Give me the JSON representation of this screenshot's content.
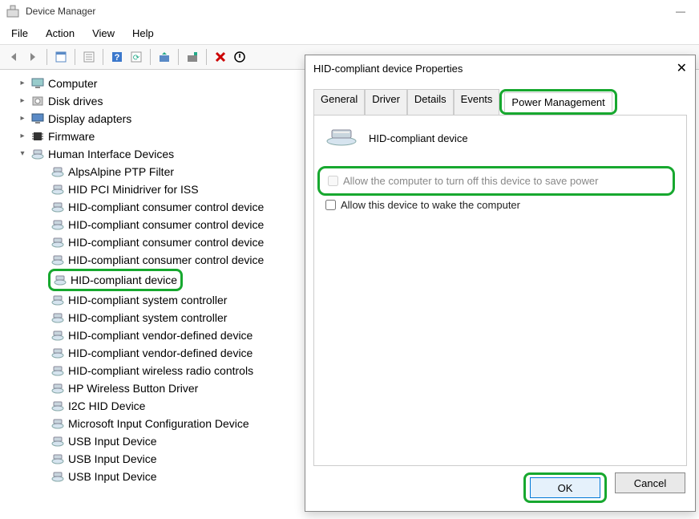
{
  "window": {
    "title": "Device Manager"
  },
  "menu": {
    "file": "File",
    "action": "Action",
    "view": "View",
    "help": "Help"
  },
  "toolbar_icons": [
    "back",
    "forward",
    "show",
    "properties",
    "help",
    "refresh",
    "monitor",
    "scan",
    "delete",
    "updown"
  ],
  "tree": {
    "categories": [
      {
        "label": "Computer",
        "expanded": false,
        "icon": "monitor"
      },
      {
        "label": "Disk drives",
        "expanded": false,
        "icon": "disk"
      },
      {
        "label": "Display adapters",
        "expanded": false,
        "icon": "display"
      },
      {
        "label": "Firmware",
        "expanded": false,
        "icon": "chip"
      },
      {
        "label": "Human Interface Devices",
        "expanded": true,
        "icon": "hid",
        "children": [
          "AlpsAlpine PTP Filter",
          "HID PCI Minidriver for ISS",
          "HID-compliant consumer control device",
          "HID-compliant consumer control device",
          "HID-compliant consumer control device",
          "HID-compliant consumer control device",
          "HID-compliant device",
          "HID-compliant system controller",
          "HID-compliant system controller",
          "HID-compliant vendor-defined device",
          "HID-compliant vendor-defined device",
          "HID-compliant wireless radio controls",
          "HP Wireless Button Driver",
          "I2C HID Device",
          "Microsoft Input Configuration Device",
          "USB Input Device",
          "USB Input Device",
          "USB Input Device"
        ],
        "highlighted_index": 6
      }
    ]
  },
  "dialog": {
    "title": "HID-compliant device Properties",
    "tabs": {
      "general": "General",
      "driver": "Driver",
      "details": "Details",
      "events": "Events",
      "power": "Power Management"
    },
    "active_tab": "power",
    "device_name": "HID-compliant device",
    "checkbox1": "Allow the computer to turn off this device to save power",
    "checkbox2": "Allow this device to wake the computer",
    "buttons": {
      "ok": "OK",
      "cancel": "Cancel"
    }
  }
}
